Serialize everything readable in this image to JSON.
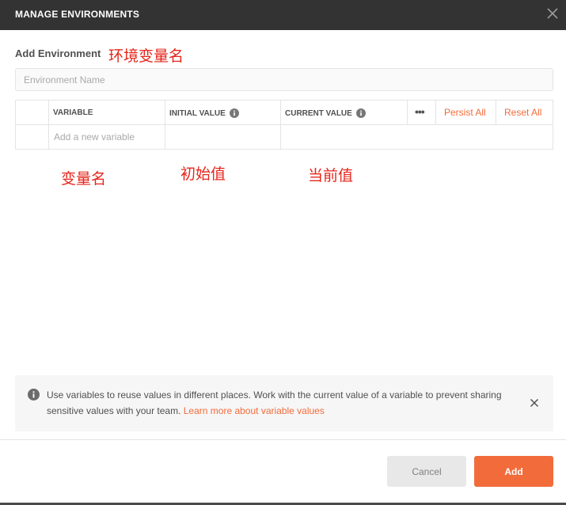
{
  "modal": {
    "title": "MANAGE ENVIRONMENTS",
    "close_icon": "close-icon"
  },
  "form": {
    "heading": "Add Environment",
    "name_placeholder": "Environment Name",
    "name_value": ""
  },
  "annotations": {
    "env_name": "环境变量名",
    "variable": "变量名",
    "initial": "初始值",
    "current": "当前值"
  },
  "table": {
    "columns": {
      "variable": "VARIABLE",
      "initial_value": "INITIAL VALUE",
      "current_value": "CURRENT VALUE"
    },
    "more_label": "•••",
    "persist_all": "Persist All",
    "reset_all": "Reset All",
    "new_variable_placeholder": "Add a new variable"
  },
  "info": {
    "text": "Use variables to reuse values in different places. Work with the current value of a variable to prevent sharing sensitive values with your team.",
    "link": "Learn more about variable values",
    "icon": "info-icon",
    "close_icon": "close-icon"
  },
  "footer": {
    "cancel_label": "Cancel",
    "add_label": "Add"
  },
  "colors": {
    "accent": "#f26b3a",
    "titlebar": "#333333",
    "annotation": "#e5251b"
  }
}
